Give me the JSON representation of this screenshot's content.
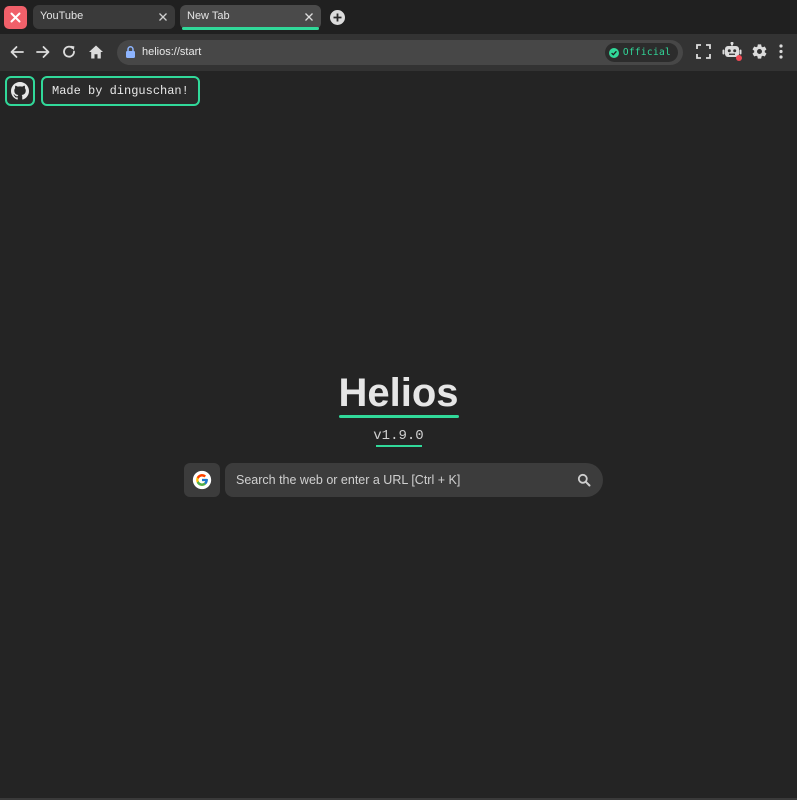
{
  "tabs": [
    {
      "label": "YouTube",
      "active": false
    },
    {
      "label": "New Tab",
      "active": true
    }
  ],
  "toolbar": {
    "url": "helios://start",
    "badge_label": "Official"
  },
  "content": {
    "github_icon": "github-icon",
    "made_by": "Made by dinguschan!",
    "title": "Helios",
    "version": "v1.9.0",
    "search_engine_icon": "google-icon",
    "search_placeholder": "Search the web or enter a URL [Ctrl + K]"
  },
  "colors": {
    "accent": "#31d99a",
    "close_button": "#f0606a",
    "notification_dot": "#f04a55",
    "background": "#242424"
  }
}
